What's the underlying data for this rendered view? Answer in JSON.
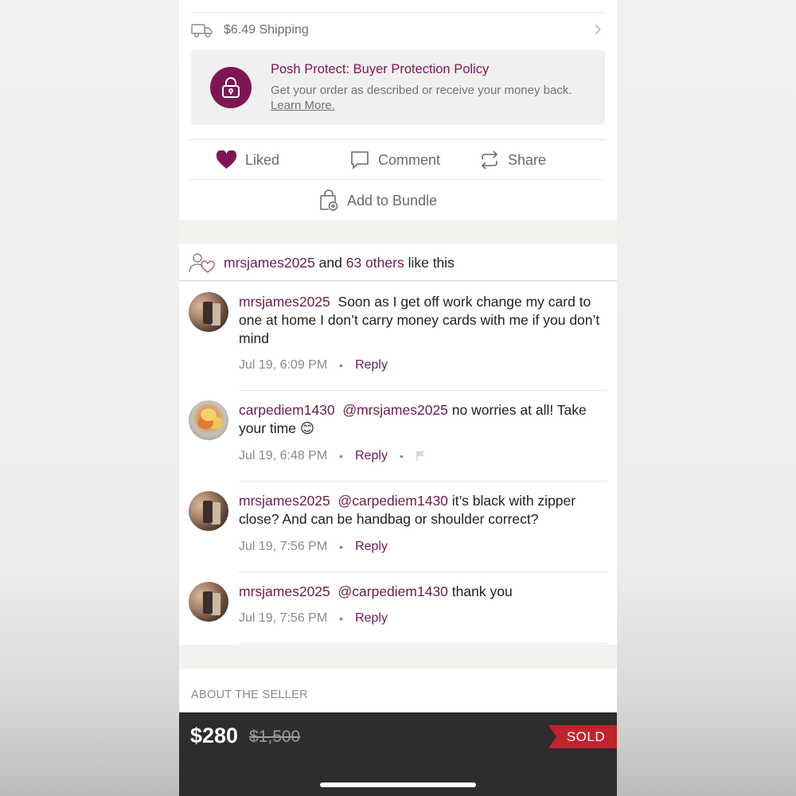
{
  "shipping": {
    "label": "$6.49 Shipping"
  },
  "protect": {
    "title": "Posh Protect: Buyer Protection Policy",
    "desc": "Get your order as described or receive your money back.",
    "learn_more": "Learn More."
  },
  "actions": {
    "liked": "Liked",
    "comment": "Comment",
    "share": "Share",
    "bundle": "Add to Bundle"
  },
  "likes": {
    "user": "mrsjames2025",
    "and": "and",
    "others": "63 others",
    "suffix": "like this"
  },
  "comments": [
    {
      "user": "mrsjames2025",
      "mention": "",
      "text": "Soon as I get off work change my card to one at home I don’t carry money cards with me if you don’t mind",
      "time": "Jul 19, 6:09 PM",
      "reply": "Reply"
    },
    {
      "user": "carpediem1430",
      "mention": "@mrsjames2025",
      "text": "no worries at all! Take your time 😊",
      "time": "Jul 19, 6:48 PM",
      "reply": "Reply"
    },
    {
      "user": "mrsjames2025",
      "mention": "@carpediem1430",
      "text": "it’s black with zipper close? And can be handbag or shoulder correct?",
      "time": "Jul 19, 7:56 PM",
      "reply": "Reply"
    },
    {
      "user": "mrsjames2025",
      "mention": "@carpediem1430",
      "text": "thank you",
      "time": "Jul 19, 7:56 PM",
      "reply": "Reply"
    }
  ],
  "about": {
    "title": "ABOUT THE SELLER"
  },
  "bottom": {
    "price": "$280",
    "original_price": "$1,500",
    "sold": "SOLD"
  },
  "colors": {
    "brand": "#7f1654",
    "link": "#6b1d4e",
    "sold": "#c0242d",
    "bar": "#2e2c2c"
  }
}
